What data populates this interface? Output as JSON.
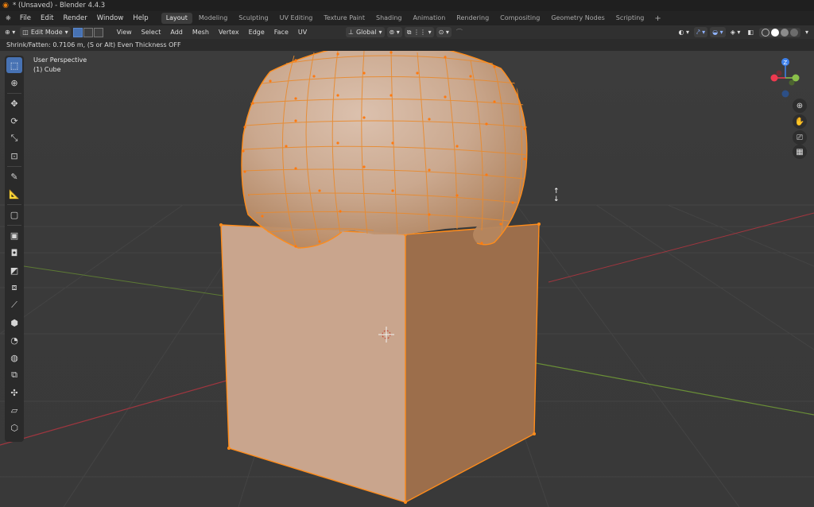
{
  "window": {
    "title": "* (Unsaved) - Blender 4.4.3"
  },
  "menu": {
    "logo_icon": "blender-icon",
    "items": [
      "File",
      "Edit",
      "Render",
      "Window",
      "Help"
    ]
  },
  "workspaces": {
    "tabs": [
      "Layout",
      "Modeling",
      "Sculpting",
      "UV Editing",
      "Texture Paint",
      "Shading",
      "Animation",
      "Rendering",
      "Compositing",
      "Geometry Nodes",
      "Scripting"
    ],
    "active": "Layout",
    "add_label": "+"
  },
  "editor_header": {
    "mode": "Edit Mode",
    "menus": [
      "View",
      "Select",
      "Add",
      "Mesh",
      "Vertex",
      "Edge",
      "Face",
      "UV"
    ],
    "transform_orientation": "Global",
    "shading_active_color": "#ffffff"
  },
  "operator_status": "Shrink/Fatten: 0.7106 m, (S or Alt) Even Thickness OFF",
  "viewport": {
    "view_name": "User Perspective",
    "object_name": "(1) Cube",
    "mesh_selection_color": "#ff8c1a",
    "axis_colors": {
      "x": "#f0394f",
      "y": "#8ac04a",
      "z": "#3f82ec"
    }
  },
  "gizmo": {
    "z_label": "Z"
  },
  "toolbar": {
    "tools": [
      "select-box-icon",
      "cursor-icon",
      "move-icon",
      "rotate-icon",
      "scale-icon",
      "transform-icon",
      "annotate-icon",
      "measure-icon",
      "add-cube-icon",
      "extrude-icon",
      "inset-icon",
      "bevel-icon",
      "loop-cut-icon",
      "knife-icon",
      "poly-build-icon",
      "spin-icon",
      "smooth-icon",
      "edge-slide-icon",
      "shrink-fatten-icon",
      "shear-icon",
      "rip-icon"
    ]
  }
}
